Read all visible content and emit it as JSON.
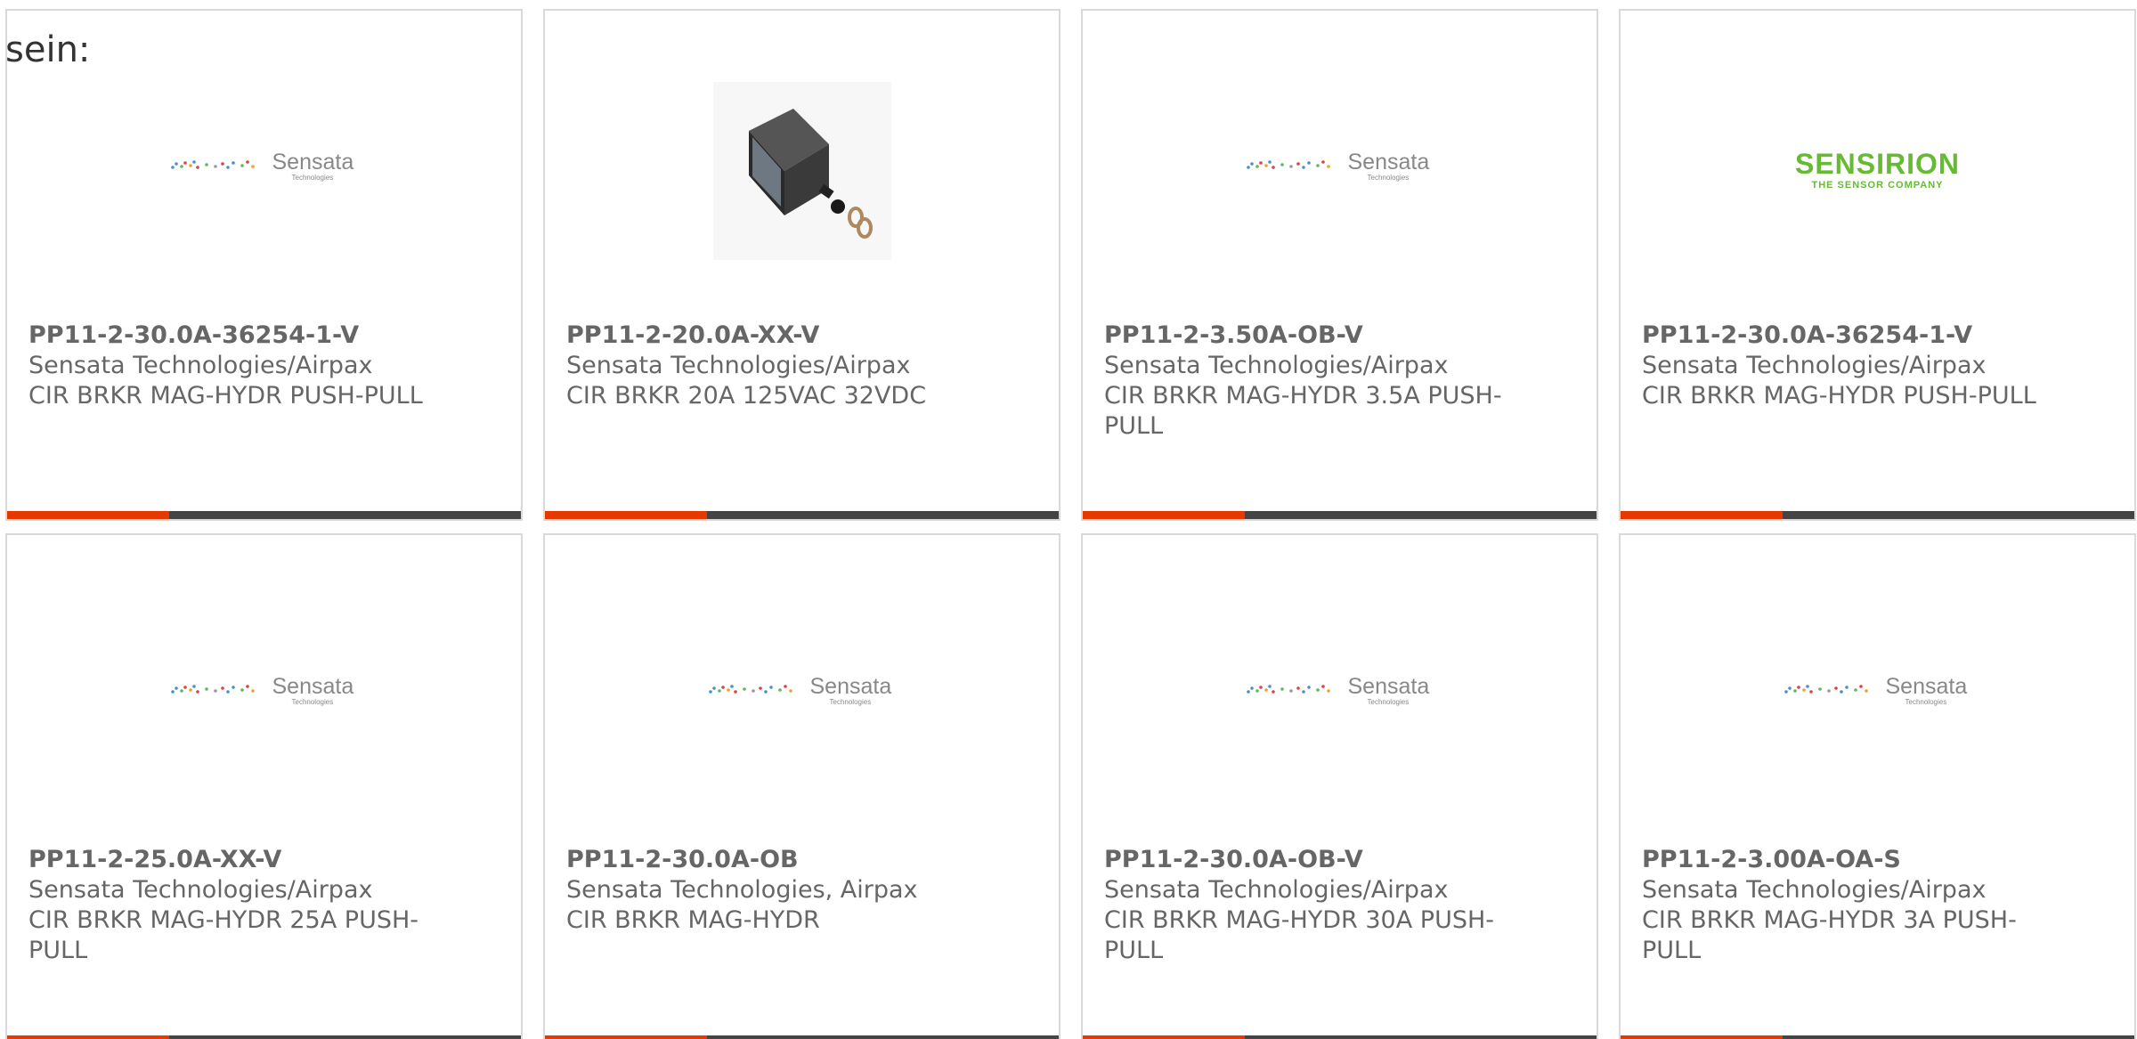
{
  "intro_text": "sein:",
  "logos": {
    "sensata_word": "Sensata",
    "sensata_sub": "Technologies",
    "sensirion_word": "SENSIRION",
    "sensirion_tag": "THE SENSOR COMPANY"
  },
  "colors": {
    "accent": "#e63900",
    "bar": "#444444",
    "border": "#d9d9d9",
    "text": "#666666",
    "sensirion_green": "#66bb33"
  },
  "cards": [
    {
      "image": "sensata-logo",
      "part": "PP11-2-30.0A-36254-1-V",
      "manufacturer": "Sensata Technologies/Airpax",
      "description": "CIR BRKR MAG-HYDR PUSH-PULL"
    },
    {
      "image": "circuit-breaker-photo",
      "part": "PP11-2-20.0A-XX-V",
      "manufacturer": "Sensata Technologies/Airpax",
      "description": "CIR BRKR 20A 125VAC 32VDC"
    },
    {
      "image": "sensata-logo",
      "part": "PP11-2-3.50A-OB-V",
      "manufacturer": "Sensata Technologies/Airpax",
      "description": "CIR BRKR MAG-HYDR 3.5A PUSH-PULL"
    },
    {
      "image": "sensirion-logo",
      "part": "PP11-2-30.0A-36254-1-V",
      "manufacturer": "Sensata Technologies/Airpax",
      "description": "CIR BRKR MAG-HYDR PUSH-PULL"
    },
    {
      "image": "sensata-logo",
      "part": "PP11-2-25.0A-XX-V",
      "manufacturer": "Sensata Technologies/Airpax",
      "description": "CIR BRKR MAG-HYDR 25A PUSH-PULL"
    },
    {
      "image": "sensata-logo",
      "part": "PP11-2-30.0A-OB",
      "manufacturer": "Sensata Technologies, Airpax",
      "description": "CIR BRKR MAG-HYDR"
    },
    {
      "image": "sensata-logo",
      "part": "PP11-2-30.0A-OB-V",
      "manufacturer": "Sensata Technologies/Airpax",
      "description": "CIR BRKR MAG-HYDR 30A PUSH-PULL"
    },
    {
      "image": "sensata-logo",
      "part": "PP11-2-3.00A-OA-S",
      "manufacturer": "Sensata Technologies/Airpax",
      "description": "CIR BRKR MAG-HYDR 3A PUSH-PULL"
    }
  ]
}
